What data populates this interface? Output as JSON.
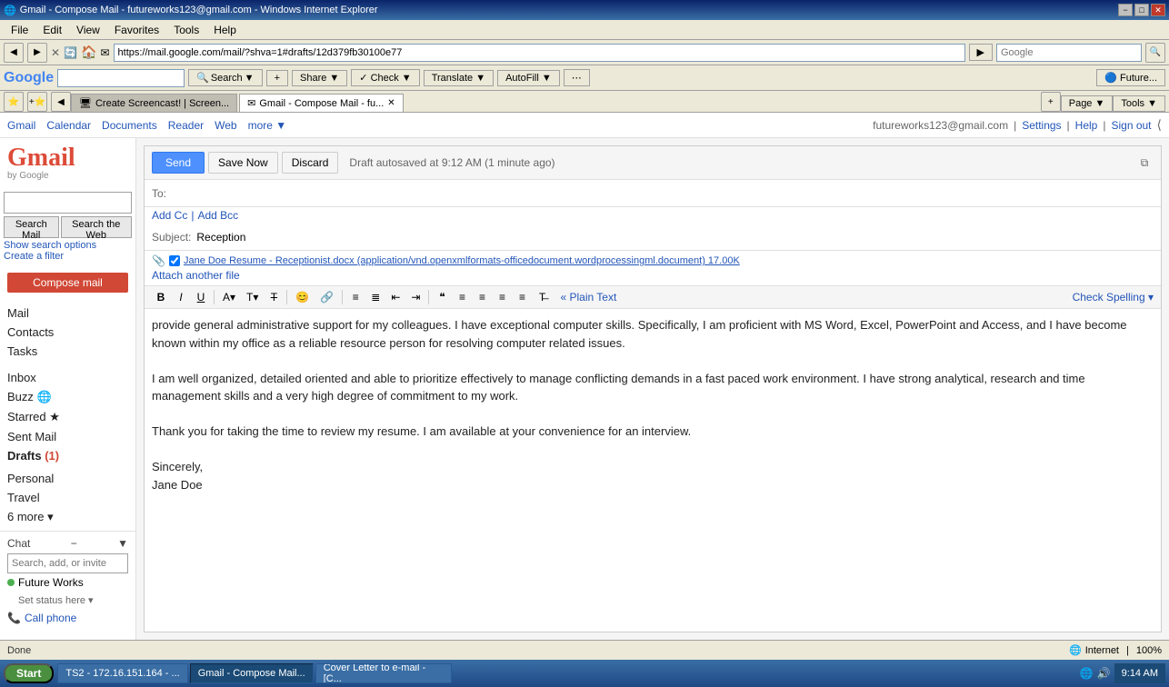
{
  "window": {
    "title": "Gmail - Compose Mail - futureworks123@gmail.com - Windows Internet Explorer",
    "titlebar_controls": [
      "−",
      "□",
      "✕"
    ]
  },
  "menu": {
    "items": [
      "File",
      "Edit",
      "View",
      "Favorites",
      "Tools",
      "Help"
    ]
  },
  "address_bar": {
    "url": "https://mail.google.com/mail/?shva=1#drafts/12d379fb30100e77",
    "search_placeholder": "Google"
  },
  "google_toolbar": {
    "search_label": "Search",
    "search_options": [
      "Search",
      "▼"
    ],
    "buttons": [
      "Share ▼",
      "Check ▼",
      "Translate ▼",
      "AutoFill ▼",
      "Future..."
    ]
  },
  "tabs": [
    {
      "label": "Create Screencast! | Screen...",
      "icon": "🖥",
      "active": false
    },
    {
      "label": "Gmail - Compose Mail - fu...",
      "icon": "✉",
      "active": true
    }
  ],
  "gmail_header": {
    "nav_links": [
      "Gmail",
      "Calendar",
      "Documents",
      "Reader",
      "Web",
      "more ▼"
    ],
    "account": "futureworks123@gmail.com",
    "account_links": [
      "Settings",
      "Help",
      "Sign out"
    ]
  },
  "search_area": {
    "search_mail_btn": "Search Mail",
    "search_web_btn": "Search the Web",
    "show_options": "Show search options",
    "create_filter": "Create a filter"
  },
  "sidebar": {
    "compose_btn": "Compose mail",
    "nav_items": [
      {
        "label": "Mail",
        "count": ""
      },
      {
        "label": "Contacts",
        "count": ""
      },
      {
        "label": "Tasks",
        "count": ""
      }
    ],
    "mail_items": [
      {
        "label": "Inbox",
        "count": ""
      },
      {
        "label": "Buzz 🌐",
        "count": ""
      },
      {
        "label": "Starred ★",
        "count": ""
      },
      {
        "label": "Sent Mail",
        "count": ""
      },
      {
        "label": "Drafts",
        "count": "(1)",
        "active": true
      }
    ],
    "labels": [
      {
        "label": "Personal"
      },
      {
        "label": "Travel"
      },
      {
        "label": "6 more ▾"
      }
    ],
    "chat_header": "Chat",
    "chat_search_placeholder": "Search, add, or invite",
    "contacts": [
      {
        "name": "Future Works",
        "status": "online",
        "set_status": "Set status here ▾"
      }
    ],
    "call_phone": "Call phone"
  },
  "compose": {
    "send_btn": "Send",
    "save_btn": "Save Now",
    "discard_btn": "Discard",
    "draft_saved": "Draft autosaved at 9:12 AM (1 minute ago)",
    "to_label": "To:",
    "to_value": "",
    "add_cc": "Add Cc",
    "add_bcc": "Add Bcc",
    "subject_label": "Subject:",
    "subject_value": "Reception",
    "attachment": {
      "filename": "Jane Doe Resume - Receptionist.docx (application/vnd.openxmlformats-officedocument.wordprocessingml.document) 17.00K",
      "attach_another": "Attach another file"
    },
    "format_toolbar": {
      "buttons": [
        "B",
        "I",
        "U",
        "A▾",
        "T▾",
        "T̶",
        "😊",
        "🔗",
        "≡",
        "≣",
        "⇤",
        "⇥",
        "❝",
        "≡",
        "≡",
        "≡",
        "≡"
      ],
      "plain_text": "« Plain Text",
      "check_spelling": "Check Spelling ▾"
    },
    "body": "provide general administrative support for my colleagues. I have exceptional computer skills.  Specifically, I am proficient with MS Word, Excel, PowerPoint and Access, and I have become known within my office as a reliable resource person for resolving computer related issues.\n\nI am well organized, detailed oriented and able to prioritize effectively to manage conflicting demands in a fast paced work environment. I have strong analytical, research and time management skills and a very high degree of commitment to my work.\n\nThank you for taking the time to review my resume.  I am available at your convenience for an interview.\n\nSincerely,\nJane Doe"
  },
  "status_bar": {
    "status": "Done",
    "zone": "Internet",
    "zoom": "100%"
  },
  "taskbar": {
    "start": "Start",
    "items": [
      {
        "label": "TS2 - 172.16.151.164 - ...",
        "active": false
      },
      {
        "label": "Gmail - Compose Mail...",
        "active": true
      },
      {
        "label": "Cover Letter to e-mail - [C...",
        "active": false
      }
    ],
    "time": "9:14 AM"
  }
}
